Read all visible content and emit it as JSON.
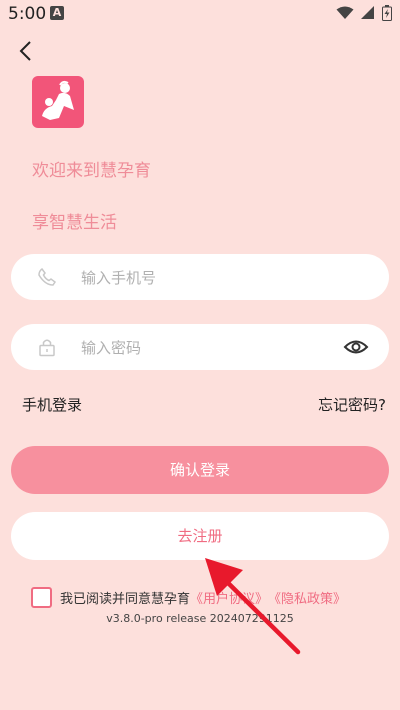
{
  "status_bar": {
    "time": "5:00",
    "notification_letter": "A"
  },
  "header": {
    "welcome": "欢迎来到慧孕育",
    "tagline": "享智慧生活"
  },
  "form": {
    "phone_placeholder": "输入手机号",
    "password_placeholder": "输入密码"
  },
  "options": {
    "phone_login": "手机登录",
    "forgot_password": "忘记密码?"
  },
  "buttons": {
    "confirm_login": "确认登录",
    "go_register": "去注册"
  },
  "agreement": {
    "text": "我已阅读并同意慧孕育",
    "user_agreement": "《用户协议》",
    "privacy_policy": "《隐私政策》"
  },
  "version": "v3.8.0-pro release 202407291125",
  "colors": {
    "background": "#fde0dc",
    "accent": "#f06c82",
    "primary_button": "#f7909e",
    "annotation_arrow": "#e8192c"
  }
}
